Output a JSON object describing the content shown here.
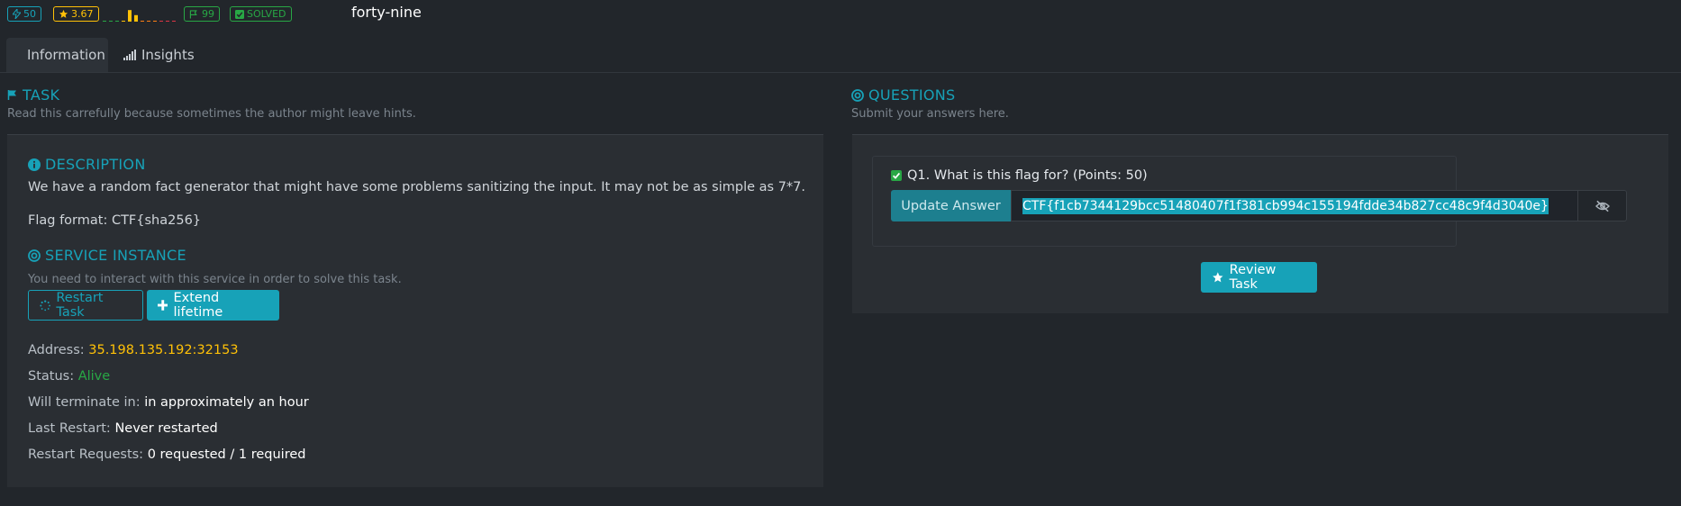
{
  "header": {
    "badge_points": "50",
    "badge_rating": "3.67",
    "badge_flags": "99",
    "badge_solved": "SOLVED",
    "title": "forty-nine"
  },
  "difficulty_spark": [
    0.05,
    0.05,
    0.05,
    0.05,
    0.8,
    0.45,
    0.05,
    0.05,
    0.05,
    0.05,
    0.05,
    0.05
  ],
  "tabs": [
    {
      "label": "Information",
      "icon": "info-circle-icon",
      "active": true
    },
    {
      "label": "Insights",
      "icon": "signal-bars-icon",
      "active": false
    }
  ],
  "task": {
    "heading": "TASK",
    "subtitle": "Read this carrefully because sometimes the author might leave hints.",
    "description_heading": "DESCRIPTION",
    "description": "We have a random fact generator that might have some problems sanitizing the input. It may not be as simple as 7*7.",
    "flag_format": "Flag format: CTF{sha256}",
    "service_heading": "SERVICE INSTANCE",
    "service_subtitle": "You need to interact with this service in order to solve this task.",
    "restart_label": "Restart Task",
    "extend_label": "Extend lifetime",
    "address_label": "Address:",
    "address_value": "35.198.135.192:32153",
    "status_label": "Status:",
    "status_value": "Alive",
    "terminate_label": "Will terminate in:",
    "terminate_value": "in approximately an hour",
    "last_restart_label": "Last Restart:",
    "last_restart_value": "Never restarted",
    "restart_requests_label": "Restart Requests:",
    "restart_requests_value": "0 requested / 1 required"
  },
  "questions": {
    "heading": "QUESTIONS",
    "subtitle": "Submit your answers here.",
    "q1_label": "Q1. What is this flag for? (Points: 50)",
    "update_label": "Update Answer",
    "answer_value": "CTF{f1cb7344129bcc51480407f1f381cb994c155194fdde34b827cc48c9f4d3040e}",
    "review_label": "Review Task"
  },
  "colors": {
    "accent": "#17a2b8",
    "warning": "#ffc107",
    "success": "#28a745",
    "danger": "#dc3545"
  }
}
